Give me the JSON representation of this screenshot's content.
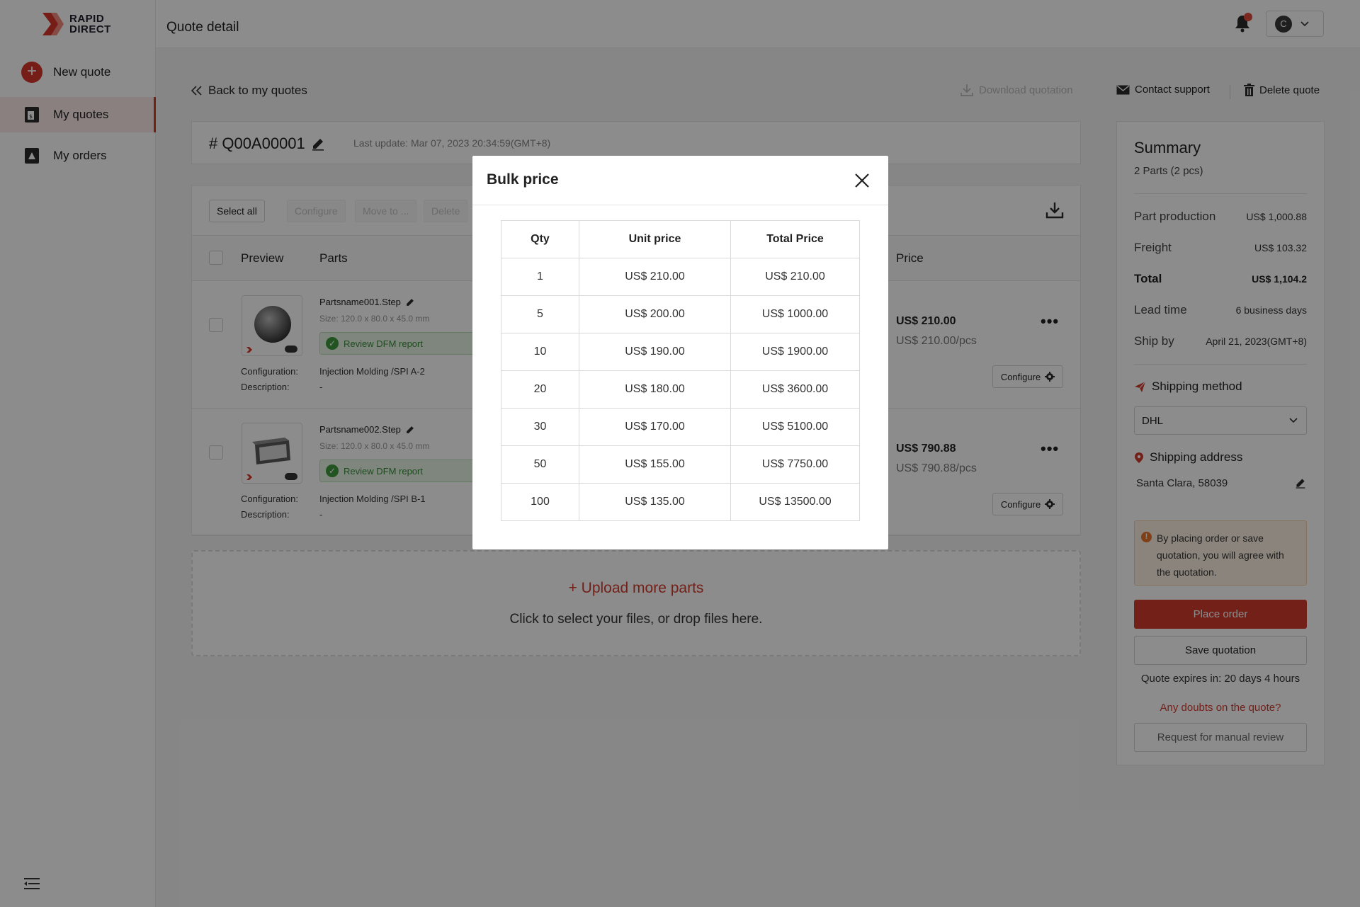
{
  "brand": {
    "line1": "RAPID",
    "line2": "DIRECT"
  },
  "sidebar": {
    "items": [
      {
        "label": "New quote"
      },
      {
        "label": "My quotes"
      },
      {
        "label": "My orders"
      }
    ]
  },
  "header": {
    "title": "Quote detail",
    "user_initial": "C"
  },
  "actions": {
    "back": "Back to my quotes",
    "download": "Download quotation",
    "contact": "Contact support",
    "delete": "Delete quote"
  },
  "quote": {
    "id": "# Q00A00001",
    "last_update": "Last update: Mar 07, 2023 20:34:59(GMT+8)"
  },
  "toolbar": {
    "select_all": "Select all",
    "configure": "Configure",
    "move_to": "Move to ...",
    "delete": "Delete"
  },
  "table": {
    "col_preview": "Preview",
    "col_parts": "Parts",
    "col_price": "Price",
    "cfg_label": "Configuration:",
    "desc_label": "Description:",
    "dfm_label": "Review DFM report",
    "configure_btn": "Configure"
  },
  "parts": [
    {
      "name": "Partsname001.Step",
      "size": "Size: 120.0 x 80.0 x 45.0 mm",
      "configuration": "Injection Molding /SPI A-2",
      "description": "-",
      "price": "US$ 210.00",
      "unit_price": "US$ 210.00/pcs"
    },
    {
      "name": "Partsname002.Step",
      "size": "Size: 120.0 x 80.0 x 45.0 mm",
      "configuration": "Injection Molding /SPI B-1",
      "description": "-",
      "price": "US$ 790.88",
      "unit_price": "US$ 790.88/pcs"
    }
  ],
  "upload": {
    "title": "+ Upload more parts",
    "subtitle": "Click to select your files, or drop files here."
  },
  "summary": {
    "title": "Summary",
    "subtitle": "2 Parts (2 pcs)",
    "rows": [
      {
        "label": "Part production",
        "value": "US$ 1,000.88"
      },
      {
        "label": "Freight",
        "value": "US$ 103.32"
      },
      {
        "label": "Total",
        "value": "US$ 1,104.2"
      },
      {
        "label": "Lead time",
        "value": "6 business days"
      },
      {
        "label": "Ship by",
        "value": "April 21, 2023(GMT+8)"
      }
    ],
    "shipping_method_title": "Shipping method",
    "shipping_method": "DHL",
    "shipping_address_title": "Shipping address",
    "shipping_address": "Santa Clara, 58039",
    "notice": "By placing order or save quotation, you will agree with the quotation.",
    "place_order": "Place order",
    "save_quotation": "Save quotation",
    "expires": "Quote expires in: 20 days 4 hours",
    "doubts": "Any doubts on the quote?",
    "manual_review": "Request for manual review"
  },
  "modal": {
    "title": "Bulk price",
    "headers": [
      "Qty",
      "Unit price",
      "Total Price"
    ],
    "rows": [
      [
        "1",
        "US$ 210.00",
        "US$ 210.00"
      ],
      [
        "5",
        "US$ 200.00",
        "US$ 1000.00"
      ],
      [
        "10",
        "US$ 190.00",
        "US$ 1900.00"
      ],
      [
        "20",
        "US$ 180.00",
        "US$ 3600.00"
      ],
      [
        "30",
        "US$ 170.00",
        "US$ 5100.00"
      ],
      [
        "50",
        "US$ 155.00",
        "US$ 7750.00"
      ],
      [
        "100",
        "US$ 135.00",
        "US$ 13500.00"
      ]
    ]
  },
  "colors": {
    "accent": "#d13b2e",
    "success": "#3d9a3d",
    "warning_bg": "#fdf0e2"
  }
}
